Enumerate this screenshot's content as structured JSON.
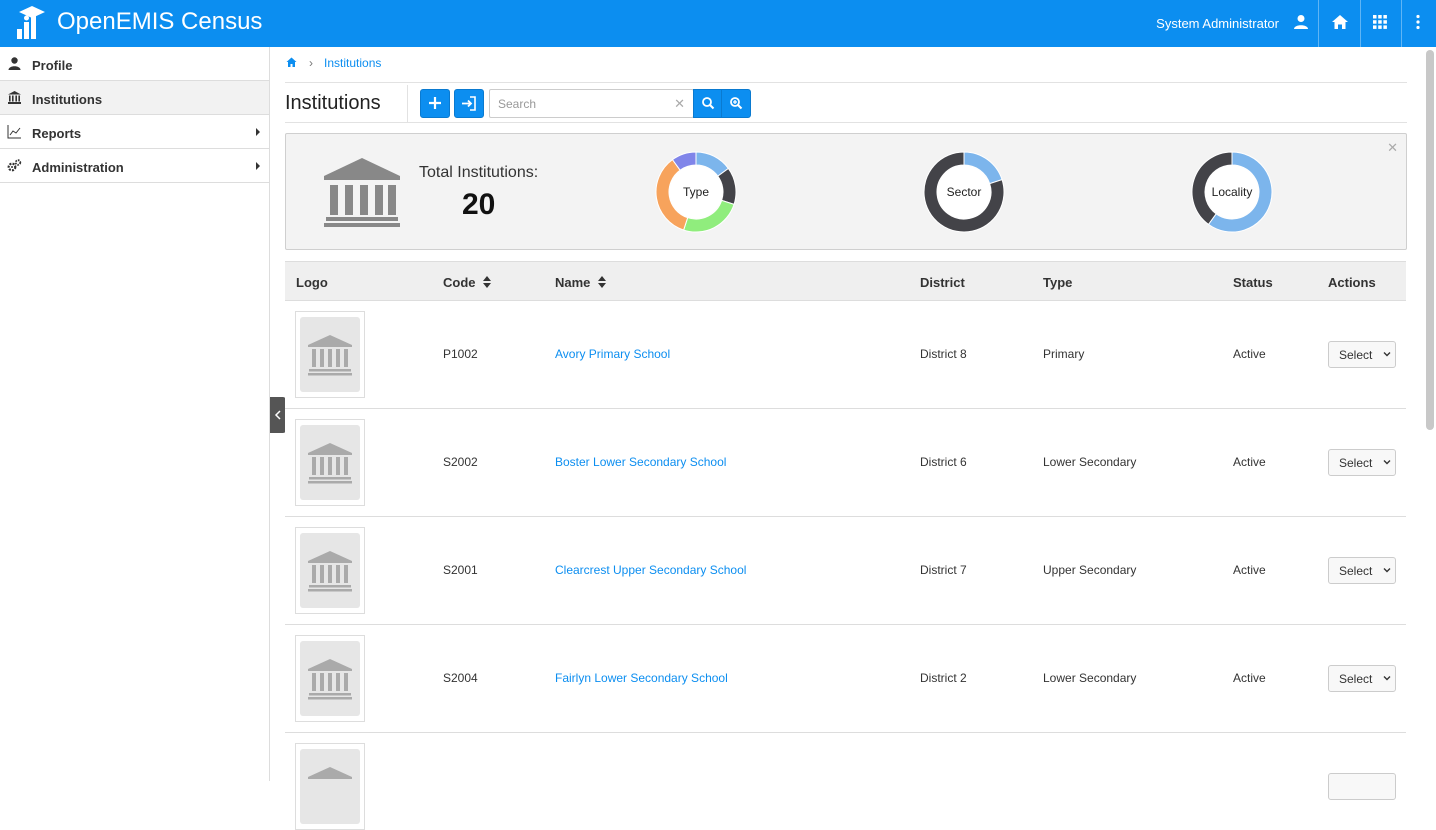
{
  "header": {
    "app_title": "OpenEMIS Census",
    "user_name": "System Administrator",
    "icons": [
      "user-icon",
      "home-icon",
      "apps-grid-icon",
      "more-vertical-icon"
    ],
    "brand_color": "#0c8ef0"
  },
  "sidebar": {
    "items": [
      {
        "label": "Profile",
        "icon": "user-icon",
        "has_arrow": false,
        "active": false
      },
      {
        "label": "Institutions",
        "icon": "bank-icon",
        "has_arrow": false,
        "active": true
      },
      {
        "label": "Reports",
        "icon": "line-chart-icon",
        "has_arrow": true,
        "active": false
      },
      {
        "label": "Administration",
        "icon": "cogs-icon",
        "has_arrow": true,
        "active": false
      }
    ]
  },
  "breadcrumb": {
    "home_icon": "home-icon",
    "current": "Institutions"
  },
  "page": {
    "title": "Institutions",
    "search_placeholder": "Search",
    "search_value": ""
  },
  "dashboard": {
    "total_label": "Total Institutions:",
    "total_value": "20",
    "charts": [
      {
        "label": "Type"
      },
      {
        "label": "Sector"
      },
      {
        "label": "Locality"
      }
    ]
  },
  "chart_data": [
    {
      "type": "pie",
      "title": "Type",
      "colors": [
        "#7cb5ec",
        "#434348",
        "#90ed7d",
        "#f7a35c",
        "#8085e9"
      ],
      "values": [
        3,
        3,
        5,
        7,
        2
      ]
    },
    {
      "type": "pie",
      "title": "Sector",
      "colors": [
        "#7cb5ec",
        "#434348"
      ],
      "values": [
        4,
        16
      ]
    },
    {
      "type": "pie",
      "title": "Locality",
      "colors": [
        "#7cb5ec",
        "#434348"
      ],
      "values": [
        12,
        8
      ]
    }
  ],
  "table": {
    "columns": [
      "Logo",
      "Code",
      "Name",
      "District",
      "Type",
      "Status",
      "Actions"
    ],
    "action_label": "Select",
    "rows": [
      {
        "code": "P1002",
        "name": "Avory Primary School",
        "district": "District 8",
        "type": "Primary",
        "status": "Active"
      },
      {
        "code": "S2002",
        "name": "Boster Lower Secondary School",
        "district": "District 6",
        "type": "Lower Secondary",
        "status": "Active"
      },
      {
        "code": "S2001",
        "name": "Clearcrest Upper Secondary School",
        "district": "District 7",
        "type": "Upper Secondary",
        "status": "Active"
      },
      {
        "code": "S2004",
        "name": "Fairlyn Lower Secondary School",
        "district": "District 2",
        "type": "Lower Secondary",
        "status": "Active"
      }
    ]
  }
}
